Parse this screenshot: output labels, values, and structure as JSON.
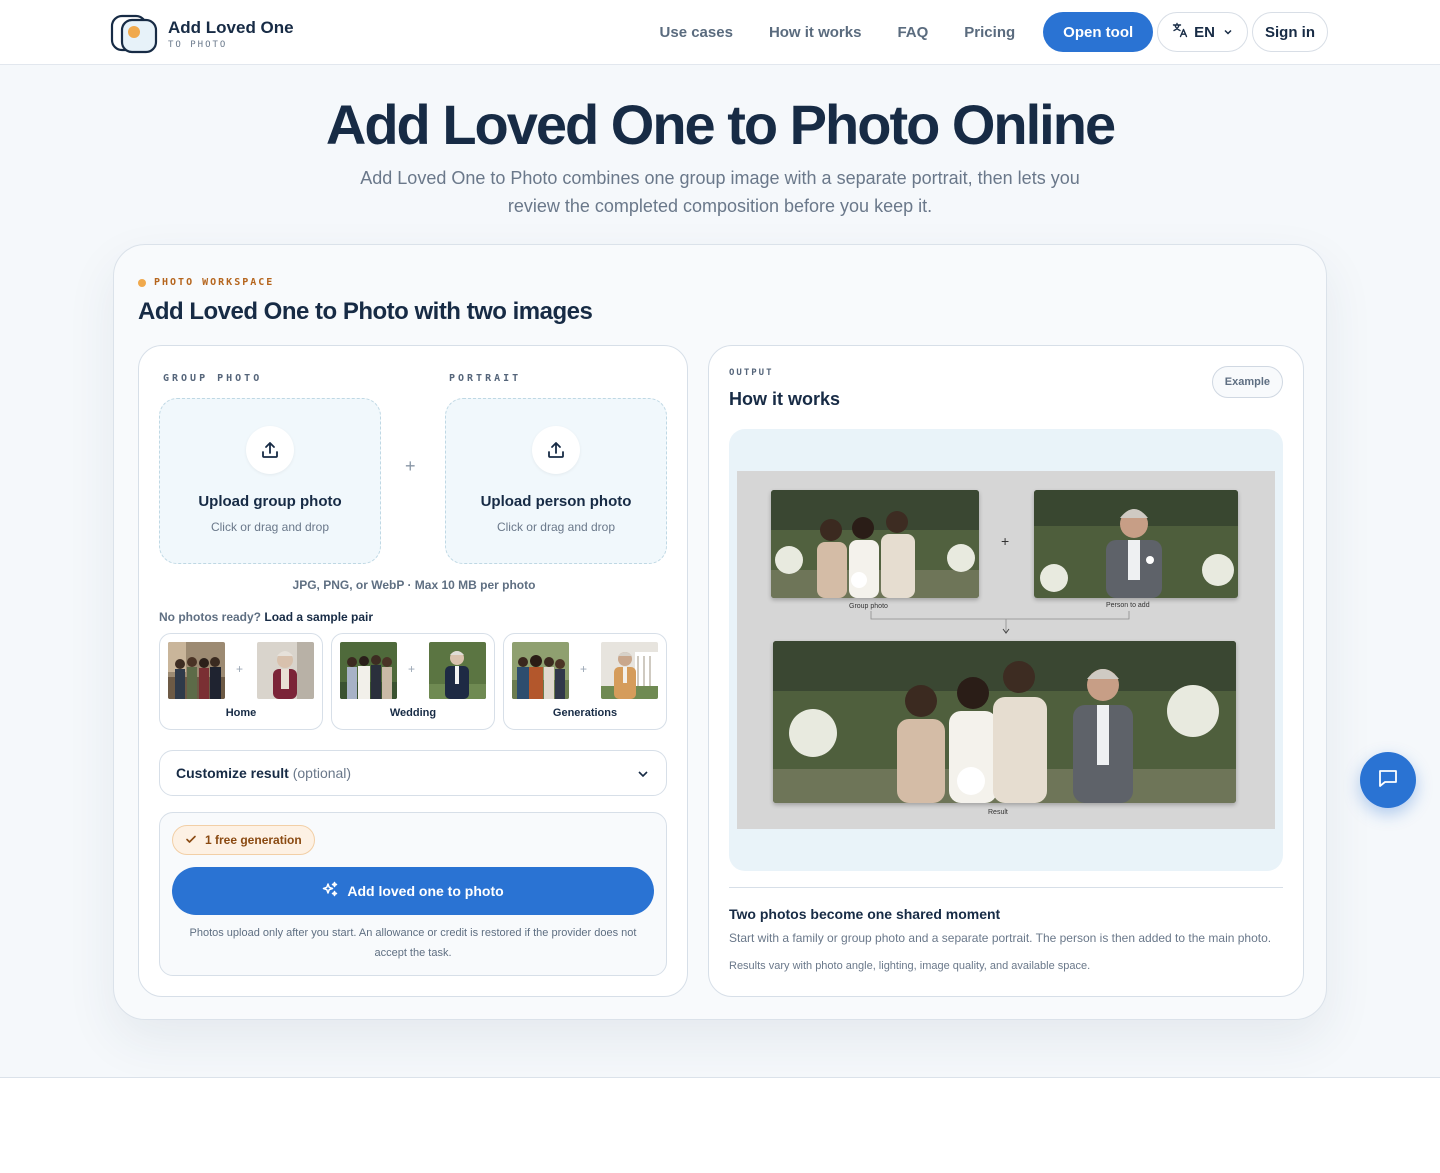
{
  "header": {
    "logo_title": "Add Loved One",
    "logo_sub": "TO PHOTO",
    "nav": [
      "Use cases",
      "How it works",
      "FAQ",
      "Pricing"
    ],
    "open_tool": "Open tool",
    "lang": "EN",
    "sign_in": "Sign in"
  },
  "hero": {
    "title": "Add Loved One to Photo Online",
    "subtitle": "Add Loved One to Photo combines one group image with a separate portrait, then lets you review the completed composition before you keep it."
  },
  "workspace": {
    "tag": "PHOTO WORKSPACE",
    "title": "Add Loved One to Photo with two images",
    "group_label": "GROUP PHOTO",
    "portrait_label": "PORTRAIT",
    "upload_group_title": "Upload group photo",
    "upload_person_title": "Upload person photo",
    "upload_sub": "Click or drag and drop",
    "plus": "+",
    "format_note": "JPG, PNG, or WebP · Max 10 MB per photo",
    "sample_prefix": "No photos ready?",
    "sample_link": "Load a sample pair",
    "samples": [
      {
        "label": "Home"
      },
      {
        "label": "Wedding"
      },
      {
        "label": "Generations"
      }
    ],
    "customize_label": "Customize result",
    "customize_optional": "(optional)",
    "free_badge": "1 free generation",
    "main_button": "Add loved one to photo",
    "gen_note": "Photos upload only after you start. An allowance or credit is restored if the provider does not accept the task."
  },
  "output": {
    "label": "OUTPUT",
    "title": "How it works",
    "example_button": "Example",
    "cap_group": "Group photo",
    "cap_person": "Person to add",
    "cap_result": "Result",
    "desc_title": "Two photos become one shared moment",
    "desc_text": "Start with a family or group photo and a separate portrait. The person is then added to the main photo.",
    "desc_note": "Results vary with photo angle, lighting, image quality, and available space."
  },
  "colors": {
    "accent": "#2a73d3",
    "heading": "#172b45",
    "muted": "#6a788a",
    "tag_orange": "#b5651d"
  }
}
